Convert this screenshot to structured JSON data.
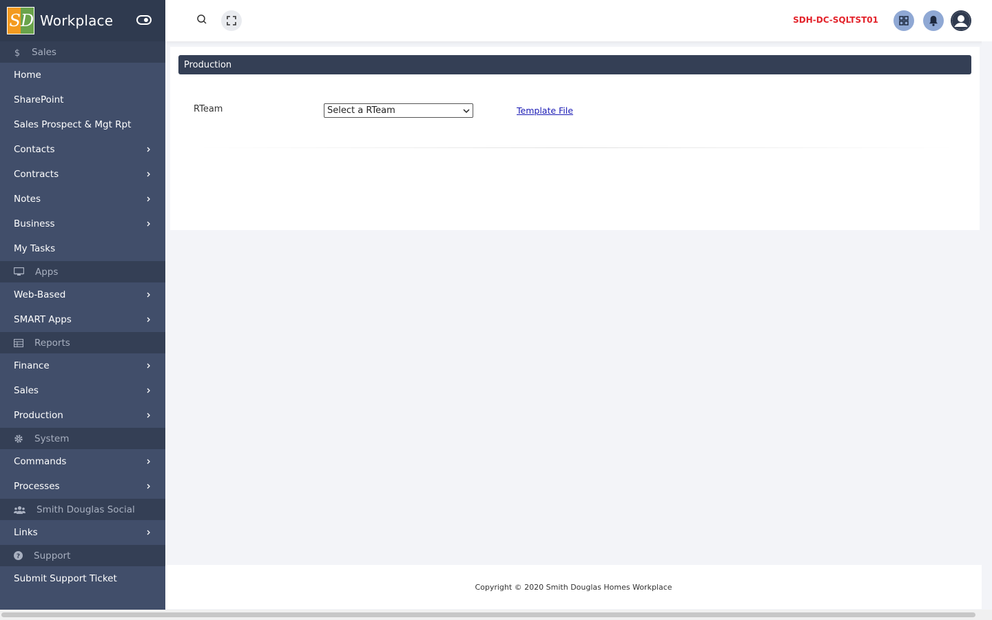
{
  "brand": {
    "name": "Workplace",
    "logo_letters": [
      "S",
      "D"
    ]
  },
  "sidebar": {
    "groups": [
      {
        "section": "Sales",
        "icon": "dollar-icon",
        "items": [
          {
            "label": "Home",
            "chevron": false
          },
          {
            "label": "SharePoint",
            "chevron": false
          },
          {
            "label": "Sales Prospect & Mgt Rpt",
            "chevron": false
          },
          {
            "label": "Contacts",
            "chevron": true
          },
          {
            "label": "Contracts",
            "chevron": true
          },
          {
            "label": "Notes",
            "chevron": true
          },
          {
            "label": "Business",
            "chevron": true
          },
          {
            "label": "My Tasks",
            "chevron": false
          }
        ]
      },
      {
        "section": "Apps",
        "icon": "monitor-icon",
        "items": [
          {
            "label": "Web-Based",
            "chevron": true
          },
          {
            "label": "SMART Apps",
            "chevron": true
          }
        ]
      },
      {
        "section": "Reports",
        "icon": "table-icon",
        "items": [
          {
            "label": "Finance",
            "chevron": true
          },
          {
            "label": "Sales",
            "chevron": true
          },
          {
            "label": "Production",
            "chevron": true
          }
        ]
      },
      {
        "section": "System",
        "icon": "gear-icon",
        "items": [
          {
            "label": "Commands",
            "chevron": true
          },
          {
            "label": "Processes",
            "chevron": true
          }
        ]
      },
      {
        "section": "Smith Douglas Social",
        "icon": "users-icon",
        "items": [
          {
            "label": "Links",
            "chevron": true
          }
        ]
      },
      {
        "section": "Support",
        "icon": "question-icon",
        "items": [
          {
            "label": "Submit Support Ticket",
            "chevron": false
          }
        ]
      }
    ]
  },
  "topbar": {
    "server": "SDH-DC-SQLTST01"
  },
  "main": {
    "header": "Production",
    "field_label": "RTeam",
    "select_value": "Select a RTeam",
    "link": "Template File"
  },
  "footer": {
    "copyright": "Copyright © 2020 Smith Douglas Homes Workplace"
  },
  "colors": {
    "sidebar": "#414e6a",
    "sidebar_section": "#343f55",
    "server_text": "#e3232b",
    "accent_button": "#8fa8d4"
  }
}
